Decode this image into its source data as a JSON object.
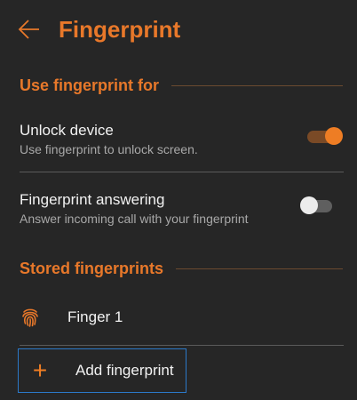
{
  "header": {
    "title": "Fingerprint"
  },
  "sections": {
    "use_for": {
      "title": "Use fingerprint for"
    },
    "stored": {
      "title": "Stored fingerprints"
    }
  },
  "settings": {
    "unlock": {
      "title": "Unlock device",
      "subtitle": "Use fingerprint to unlock screen.",
      "enabled": true
    },
    "answering": {
      "title": "Fingerprint answering",
      "subtitle": "Answer incoming call with your fingerprint",
      "enabled": false
    }
  },
  "fingerprints": [
    {
      "label": "Finger 1"
    }
  ],
  "add": {
    "label": "Add fingerprint"
  },
  "colors": {
    "accent": "#e8782a",
    "background": "#262626",
    "focus": "#2b79c9"
  },
  "icons": {
    "back": "arrow-left-icon",
    "fingerprint": "fingerprint-icon",
    "add": "plus-icon"
  }
}
